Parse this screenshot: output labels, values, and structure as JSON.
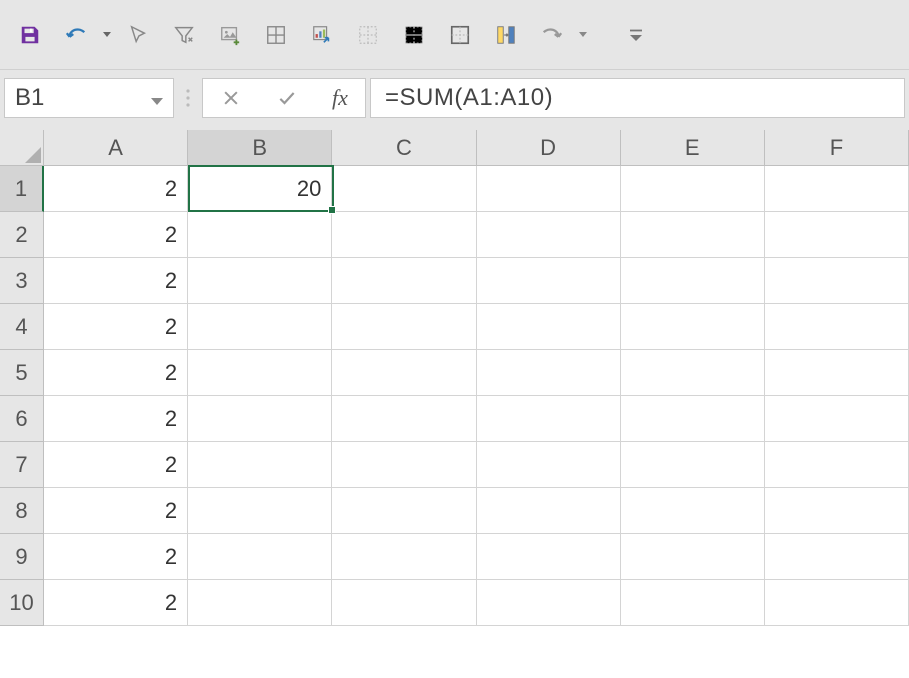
{
  "toolbar": {
    "icons": [
      {
        "name": "save-icon",
        "color": "#7030a0"
      },
      {
        "name": "undo-icon",
        "color": "#2f7ab8",
        "hasDropdown": true
      },
      {
        "name": "cursor-icon",
        "color": "#777"
      },
      {
        "name": "filter-icon",
        "color": "#777"
      },
      {
        "name": "image-plus-icon",
        "color": "#777"
      },
      {
        "name": "border-grid-icon",
        "color": "#777"
      },
      {
        "name": "chart-data-icon",
        "color": "#777"
      },
      {
        "name": "border-dotted-icon",
        "color": "#777"
      },
      {
        "name": "border-sides-icon",
        "color": "#777"
      },
      {
        "name": "border-solid-icon",
        "color": "#777"
      },
      {
        "name": "highlight-columns-icon",
        "color": "#777"
      },
      {
        "name": "redo-icon",
        "color": "#777",
        "hasDropdown": true
      },
      {
        "name": "more-commands-icon",
        "color": "#777"
      }
    ]
  },
  "formula_bar": {
    "name_box": "B1",
    "fx_label": "fx",
    "formula": "=SUM(A1:A10)"
  },
  "grid": {
    "columns": [
      "A",
      "B",
      "C",
      "D",
      "E",
      "F"
    ],
    "rows": [
      "1",
      "2",
      "3",
      "4",
      "5",
      "6",
      "7",
      "8",
      "9",
      "10"
    ],
    "selected_column_index": 1,
    "selected_row_index": 0,
    "active_cell": {
      "col": 1,
      "row": 0
    },
    "data": {
      "A1": "2",
      "A2": "2",
      "A3": "2",
      "A4": "2",
      "A5": "2",
      "A6": "2",
      "A7": "2",
      "A8": "2",
      "A9": "2",
      "A10": "2",
      "B1": "20"
    }
  }
}
